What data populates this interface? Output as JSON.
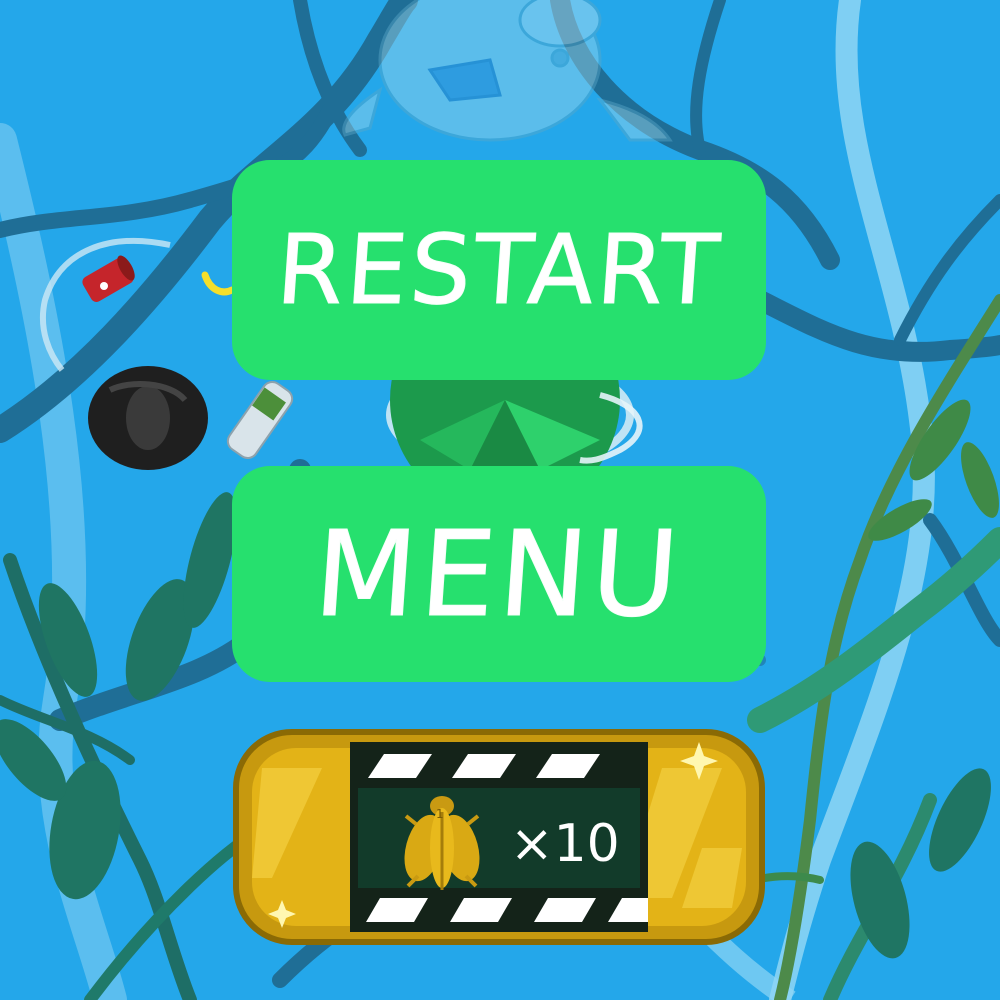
{
  "buttons": {
    "restart_label": "RESTART",
    "menu_label": "MENU"
  },
  "reward": {
    "count_label": "×10",
    "item_icon": "firefly-icon",
    "marker": "1"
  },
  "colors": {
    "water": "#24a7ea",
    "button_green": "#26e06e",
    "reward_gold": "#e3b317",
    "reward_panel": "#123b2a"
  }
}
